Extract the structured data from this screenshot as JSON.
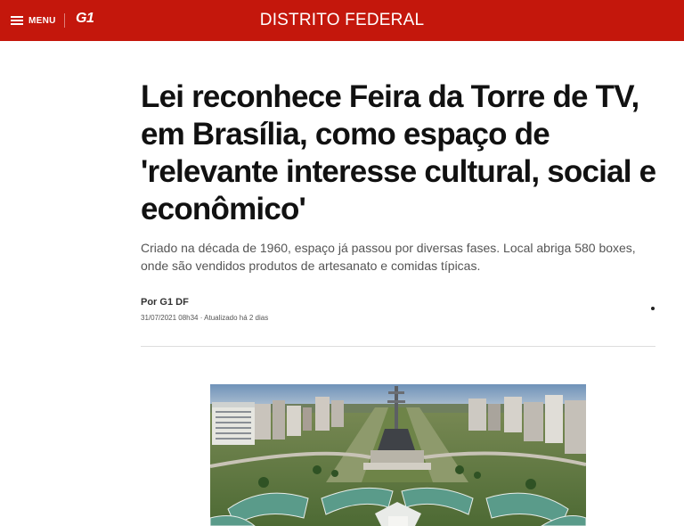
{
  "header": {
    "menu_label": "MENU",
    "logo_text": "G1",
    "section": "DISTRITO FEDERAL",
    "colors": {
      "brand": "#c4170c",
      "text_on_brand": "#ffffff"
    }
  },
  "article": {
    "headline": "Lei reconhece Feira da Torre de TV, em Brasília, como espaço de 'relevante interesse cultural, social e econômico'",
    "subtitle": "Criado na década de 1960, espaço já passou por diversas fases. Local abriga 580 boxes, onde são vendidos produtos de artesanato e comidas típicas.",
    "byline": "Por G1 DF",
    "dateline": "31/07/2021 08h34 · Atualizado há 2 dias"
  },
  "icons": {
    "menu": "hamburger-icon",
    "more": "more-options-icon"
  }
}
